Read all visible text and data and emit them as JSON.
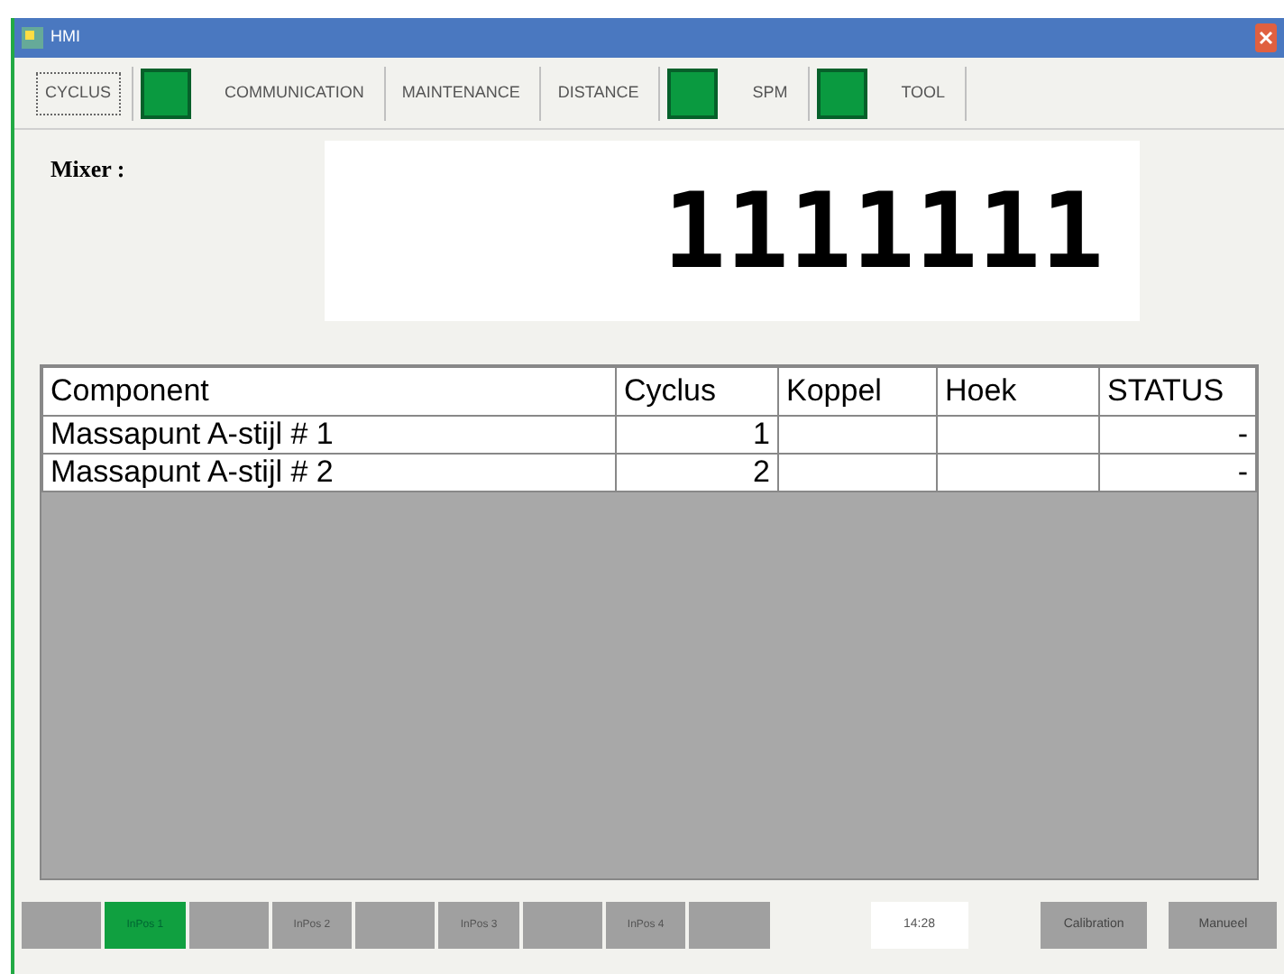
{
  "window": {
    "title": "HMI"
  },
  "tabs": [
    {
      "label": "CYCLUS",
      "selected": true,
      "indicator": false
    },
    {
      "label": "COMMUNICATION",
      "selected": false,
      "indicator": true
    },
    {
      "label": "MAINTENANCE",
      "selected": false,
      "indicator": false
    },
    {
      "label": "DISTANCE",
      "selected": false,
      "indicator": false
    },
    {
      "label": "SPM",
      "selected": false,
      "indicator": true
    },
    {
      "label": "TOOL",
      "selected": false,
      "indicator": true
    }
  ],
  "counter": {
    "label": "Mixer :",
    "value": "1111111"
  },
  "table": {
    "columns": [
      "Component",
      "Cyclus",
      "Koppel",
      "Hoek",
      "STATUS"
    ],
    "rows": [
      [
        "Massapunt A-stijl # 1",
        "1",
        "",
        "",
        "-"
      ],
      [
        "Massapunt A-stijl # 2",
        "2",
        "",
        "",
        "-"
      ]
    ]
  },
  "status_bar": [
    {
      "kind": "lamp",
      "on": false
    },
    {
      "kind": "lamp",
      "label": "InPos 1",
      "on": true
    },
    {
      "kind": "lamp",
      "on": false
    },
    {
      "kind": "lamp",
      "label": "InPos 2",
      "on": false
    },
    {
      "kind": "lamp",
      "on": false
    },
    {
      "kind": "lamp",
      "label": "InPos 3",
      "on": false
    },
    {
      "kind": "lamp",
      "on": false
    },
    {
      "kind": "lamp",
      "label": "InPos 4",
      "on": false
    },
    {
      "kind": "lamp",
      "on": false
    },
    {
      "kind": "gap"
    },
    {
      "kind": "clock",
      "label": "14:28"
    },
    {
      "kind": "button",
      "label": "Calibration"
    },
    {
      "kind": "button",
      "label": "Manueel"
    }
  ]
}
